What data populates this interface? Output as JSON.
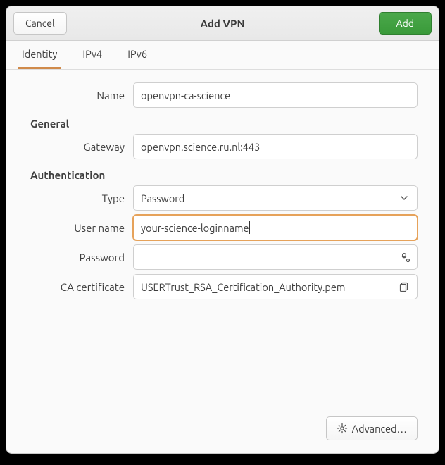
{
  "header": {
    "cancel_label": "Cancel",
    "title": "Add VPN",
    "add_label": "Add"
  },
  "tabs": [
    {
      "label": "Identity",
      "active": true
    },
    {
      "label": "IPv4",
      "active": false
    },
    {
      "label": "IPv6",
      "active": false
    }
  ],
  "identity": {
    "name_label": "Name",
    "name_value": "openvpn-ca-science",
    "general_section": "General",
    "gateway_label": "Gateway",
    "gateway_value": "openvpn.science.ru.nl:443",
    "auth_section": "Authentication",
    "type_label": "Type",
    "type_value": "Password",
    "username_label": "User name",
    "username_value": "your-science-loginname",
    "password_label": "Password",
    "password_value": "",
    "ca_label": "CA certificate",
    "ca_value": "USERTrust_RSA_Certification_Authority.pem"
  },
  "footer": {
    "advanced_label": "Advanced…"
  }
}
